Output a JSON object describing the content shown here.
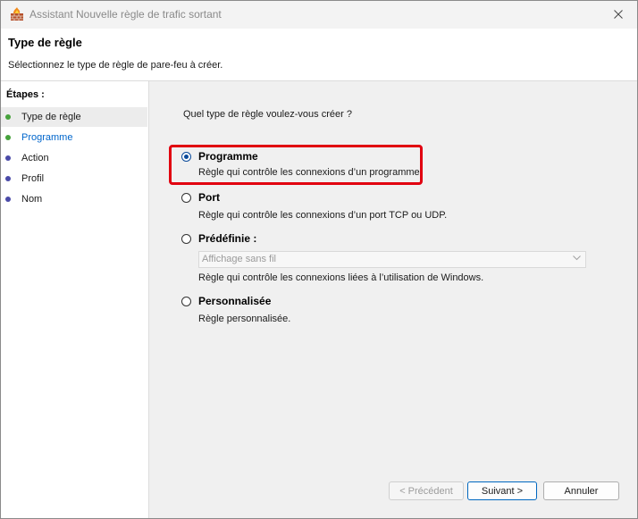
{
  "window": {
    "title": "Assistant Nouvelle règle de trafic sortant"
  },
  "header": {
    "title": "Type de règle",
    "subtitle": "Sélectionnez le type de règle de pare-feu à créer."
  },
  "steps": {
    "title": "Étapes :",
    "items": [
      {
        "label": "Type de règle",
        "status": "done",
        "color": "#46a23c"
      },
      {
        "label": "Programme",
        "status": "done",
        "color": "#46a23c",
        "link": true
      },
      {
        "label": "Action",
        "status": "pending",
        "color": "#4a4aa8"
      },
      {
        "label": "Profil",
        "status": "pending",
        "color": "#4a4aa8"
      },
      {
        "label": "Nom",
        "status": "pending",
        "color": "#4a4aa8"
      }
    ]
  },
  "main": {
    "question": "Quel type de règle voulez-vous créer ?",
    "options": [
      {
        "label": "Programme",
        "desc": "Règle qui contrôle les connexions d’un programme.",
        "checked": true
      },
      {
        "label": "Port",
        "desc": "Règle qui contrôle les connexions d’un port TCP ou UDP.",
        "checked": false
      },
      {
        "label": "Prédéfinie :",
        "desc": "Règle qui contrôle les connexions liées à l’utilisation de Windows.",
        "checked": false,
        "select_value": "Affichage sans fil"
      },
      {
        "label": "Personnalisée",
        "desc": "Règle personnalisée.",
        "checked": false
      }
    ]
  },
  "buttons": {
    "previous": "< Précédent",
    "next": "Suivant >",
    "cancel": "Annuler"
  },
  "colors": {
    "highlight": "#e10010",
    "accent": "#0067c0",
    "link": "#0066cc"
  }
}
